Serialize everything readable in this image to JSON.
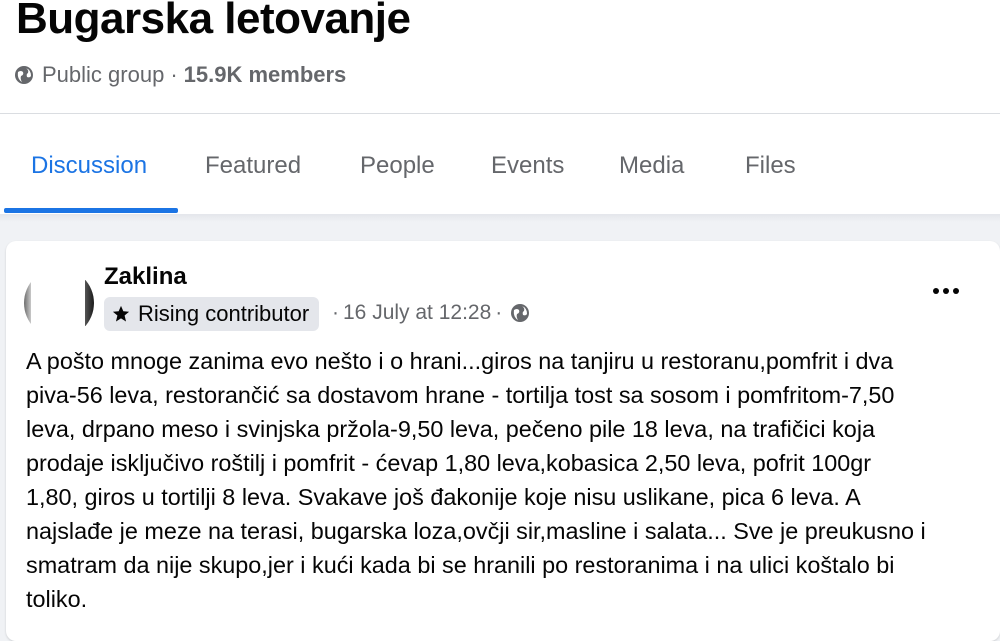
{
  "group": {
    "title": "Bugarska letovanje",
    "privacy": "Public group",
    "separator": "·",
    "members": "15.9K members"
  },
  "tabs": [
    {
      "label": "Discussion",
      "active": true
    },
    {
      "label": "Featured",
      "active": false
    },
    {
      "label": "People",
      "active": false
    },
    {
      "label": "Events",
      "active": false
    },
    {
      "label": "Media",
      "active": false
    },
    {
      "label": "Files",
      "active": false
    }
  ],
  "post": {
    "author": "Zaklina",
    "badge": "Rising contributor",
    "time_separator": "·",
    "timestamp": "16 July at 12:28",
    "time_separator2": "·",
    "body_lines": [
      "A pošto mnoge zanima evo nešto i o hrani...giros na tanjiru u restoranu,pomfrit i dva",
      "piva-56 leva, restorančić sa dostavom hrane - tortilja tost sa sosom i pomfritom-7,50",
      "leva, drpano meso i svinjska pržola-9,50 leva, pečeno pile 18 leva, na trafičici koja",
      "prodaje isključivo roštilj i pomfrit - ćevap 1,80 leva,kobasica 2,50 leva, pofrit  100gr",
      "1,80, giros u tortilji 8 leva. Svakave još đakonije koje nisu uslikane, pica 6 leva.  A",
      "najslađe je meze na terasi, bugarska loza,ovčji sir,masline  i salata... Sve je preukusno i",
      "smatram da nije skupo,jer i kući kada bi se hranili po restoranima i na ulici koštalo bi",
      "toliko."
    ]
  },
  "icons": {
    "privacy": "globe-icon",
    "badge": "star-icon",
    "audience": "globe-icon",
    "menu": "more-options-icon"
  },
  "colors": {
    "accent": "#1b74e4",
    "secondary_text": "#65676b",
    "background": "#f0f2f5"
  }
}
